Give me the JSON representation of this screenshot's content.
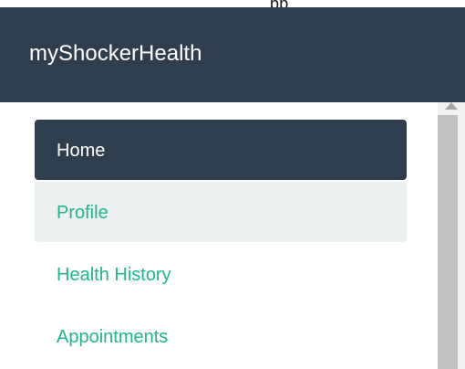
{
  "window": {
    "top_fragment": "pp"
  },
  "header": {
    "brand": "myShockerHealth"
  },
  "sidebar": {
    "items": [
      {
        "label": "Home",
        "state": "active"
      },
      {
        "label": "Profile",
        "state": "hover"
      },
      {
        "label": "Health History",
        "state": "default"
      },
      {
        "label": "Appointments",
        "state": "default"
      }
    ]
  },
  "colors": {
    "header_background": "#2f3e4f",
    "active_background": "#2f3e4f",
    "hover_background": "#ecf0f1",
    "accent_text": "#20b58b",
    "scrollbar_thumb": "#c1c1c1"
  }
}
